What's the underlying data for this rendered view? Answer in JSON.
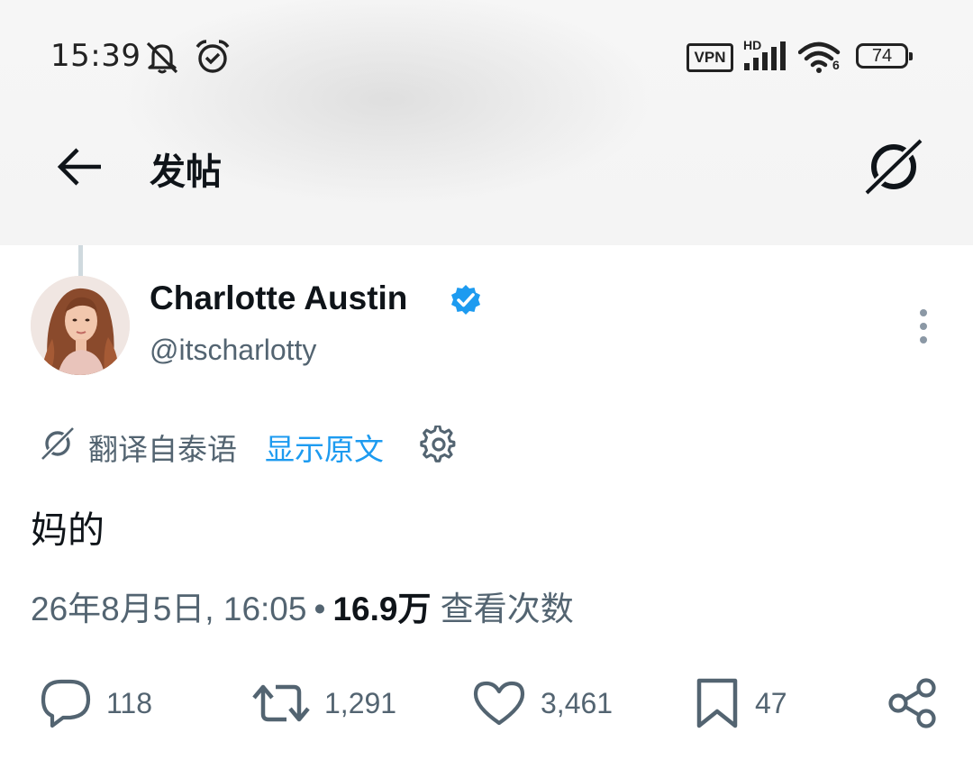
{
  "status_bar": {
    "time": "15:39",
    "vpn_label": "VPN",
    "network_label": "HD",
    "wifi_label": "6",
    "battery_level": "74",
    "icons": [
      "mute-icon",
      "alarm-icon",
      "vpn-icon",
      "signal-icon",
      "wifi-icon",
      "battery-icon"
    ]
  },
  "header": {
    "title": "发帖",
    "back_icon": "arrow-left-icon",
    "grok_icon": "grok-icon"
  },
  "post": {
    "author_name": "Charlotte Austin",
    "author_handle": "@itscharlotty",
    "verified": true,
    "translation_note": "翻译自泰语",
    "show_original_label": "显示原文",
    "text": "妈的",
    "timestamp": "26年8月5日, 16:05",
    "separator": "•",
    "views_count": "16.9万",
    "views_label": "查看次数"
  },
  "actions": {
    "replies": "118",
    "reposts": "1,291",
    "likes": "3,461",
    "bookmarks": "47"
  },
  "colors": {
    "link": "#1d9bf0",
    "secondary_text": "#536471",
    "primary_text": "#0f1419",
    "thread_line": "#cfd9de"
  }
}
